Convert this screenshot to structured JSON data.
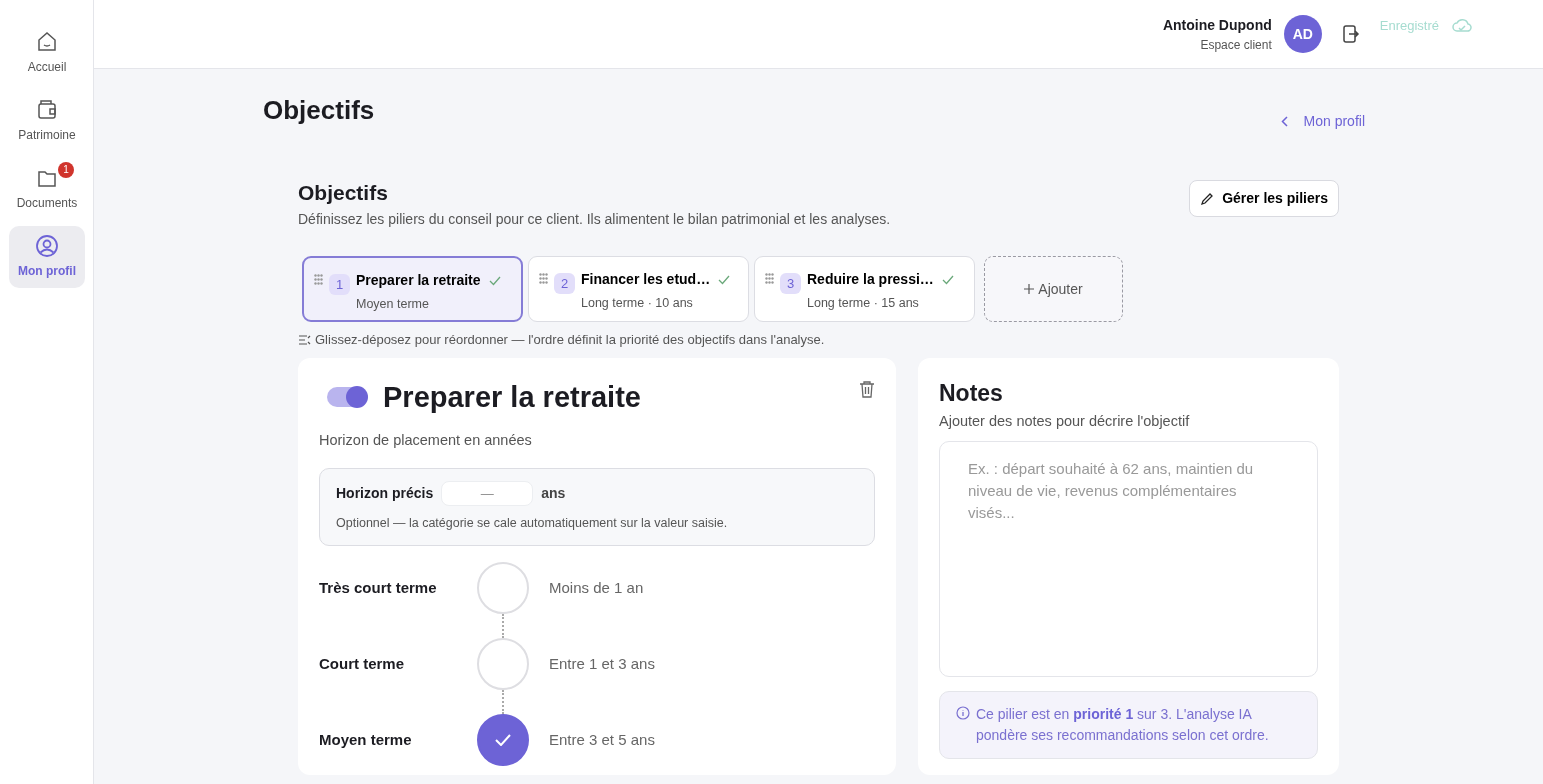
{
  "sidebar": {
    "items": [
      {
        "label": "Accueil",
        "selected": false
      },
      {
        "label": "Patrimoine",
        "selected": false
      },
      {
        "label": "Documents",
        "selected": false,
        "badge": "1"
      },
      {
        "label": "Mon profil",
        "selected": true
      }
    ]
  },
  "header": {
    "user_name": "Antoine Dupond",
    "user_role": "Espace client",
    "avatar": "AD",
    "save_status": "Enregistré"
  },
  "page": {
    "title": "Objectifs",
    "back_link": "Mon profil"
  },
  "section": {
    "title": "Objectifs",
    "description": "Définissez les piliers du conseil pour ce client. Ils alimentent le bilan patrimonial et les analyses.",
    "manage_button": "Gérer les piliers"
  },
  "pillars": [
    {
      "number": "1",
      "title": "Preparer la retraite",
      "subtitle": "Moyen terme",
      "selected": true,
      "done": true
    },
    {
      "number": "2",
      "title": "Financer les etud…",
      "subtitle": "Long terme · 10 ans",
      "selected": false,
      "done": true
    },
    {
      "number": "3",
      "title": "Reduire la pressi…",
      "subtitle": "Long terme · 15 ans",
      "selected": false,
      "done": true
    }
  ],
  "add_button": "Ajouter",
  "reorder_hint": "Glissez-déposez pour réordonner — l'ordre définit la priorité des objectifs dans l'analyse.",
  "detail": {
    "enabled": true,
    "title": "Preparer la retraite",
    "horizon_label": "Horizon de placement en années",
    "precise": {
      "label": "Horizon précis",
      "placeholder": "—",
      "unit": "ans",
      "help": "Optionnel — la catégorie se cale automatiquement sur la valeur saisie."
    },
    "horizons": [
      {
        "label": "Très court terme",
        "range": "Moins de 1 an",
        "selected": false
      },
      {
        "label": "Court terme",
        "range": "Entre 1 et 3 ans",
        "selected": false
      },
      {
        "label": "Moyen terme",
        "range": "Entre 3 et 5 ans",
        "selected": true
      }
    ]
  },
  "notes": {
    "title": "Notes",
    "subtitle": "Ajouter des notes pour décrire l'objectif",
    "placeholder": "Ex. : départ souhaité à 62 ans, maintien du niveau de vie, revenus complémentaires visés...",
    "info": "Ce pilier est en **priorité 1** sur 3. L'analyse IA pondère ses recommandations selon cet ordre."
  }
}
